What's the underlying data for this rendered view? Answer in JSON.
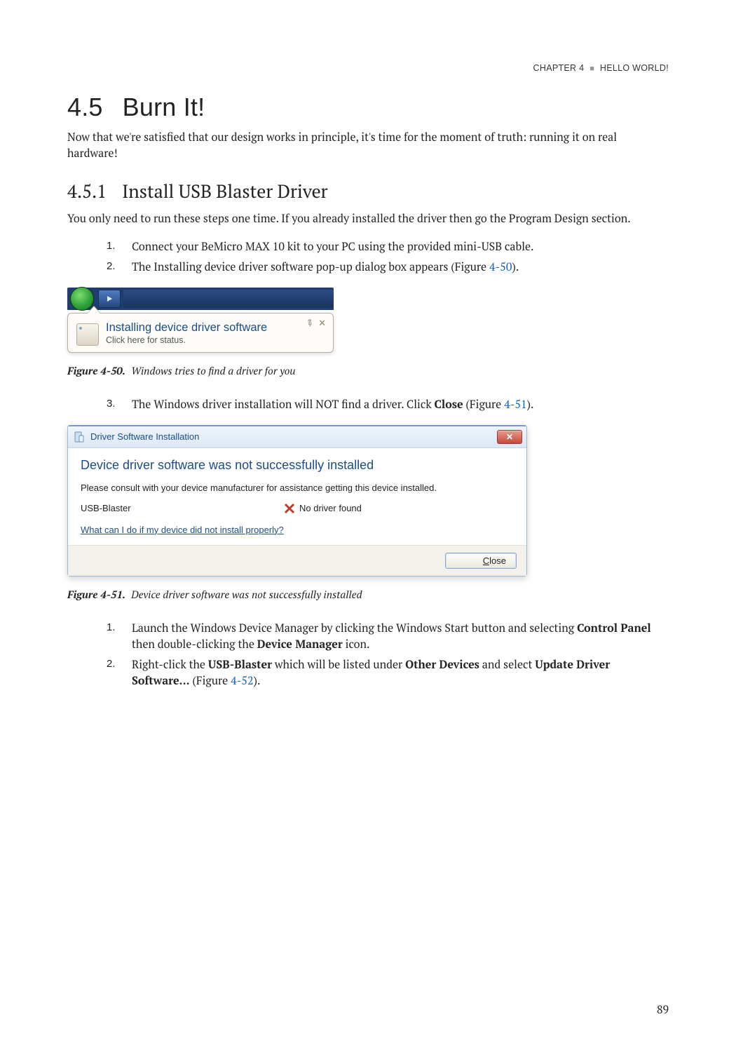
{
  "header": {
    "chapter": "Chapter 4",
    "title": "Hello World!"
  },
  "section": {
    "num": "4.5",
    "title": "Burn It!"
  },
  "intro": "Now that we're satisfied that our design works in principle, it's time for the moment of truth: running it on real hardware!",
  "subsection": {
    "num": "4.5.1",
    "title": "Install USB Blaster Driver"
  },
  "sub_intro": "You only need to run these steps one time. If you already installed the driver then go the Program Design section.",
  "steps_a": [
    {
      "n": "1.",
      "text": "Connect your BeMicro MAX 10 kit to your PC using the provided mini-USB cable."
    },
    {
      "n": "2.",
      "pre": "The Installing device driver software pop-up dialog box appears (Figure ",
      "ref": "4-50",
      "post": ")."
    }
  ],
  "fig50": {
    "balloon_title": "Installing device driver software",
    "balloon_sub": "Click here for status.",
    "caption_label": "Figure 4-50.",
    "caption_text": "Windows tries to find a driver for you"
  },
  "steps_b": [
    {
      "n": "3.",
      "pre": "The Windows driver installation will NOT find a driver. Click ",
      "bold": "Close",
      "mid": " (Figure ",
      "ref": "4-51",
      "post": ")."
    }
  ],
  "fig51": {
    "title": "Driver Software Installation",
    "headline": "Device driver software was not successfully installed",
    "msg": "Please consult with your device manufacturer for assistance getting this device installed.",
    "device": "USB-Blaster",
    "status": "No driver found",
    "link": "What can I do if my device did not install properly?",
    "close_u": "C",
    "close_rest": "lose",
    "caption_label": "Figure 4-51.",
    "caption_text": "Device driver software was not successfully installed"
  },
  "steps_c": [
    {
      "n": "1.",
      "pre": "Launch the Windows Device Manager by clicking the Windows Start button and selecting ",
      "b1": "Control Panel",
      "mid": " then double-clicking the ",
      "b2": "Device Manager",
      "post": " icon."
    },
    {
      "n": "2.",
      "pre": "Right-click the ",
      "b1": "USB-Blaster",
      "mid": " which will be listed under ",
      "b2": "Other Devices",
      "mid2": " and select ",
      "b3": "Update Driver Software...",
      "mid3": " (Figure ",
      "ref": "4-52",
      "post": ")."
    }
  ],
  "page_number": "89"
}
